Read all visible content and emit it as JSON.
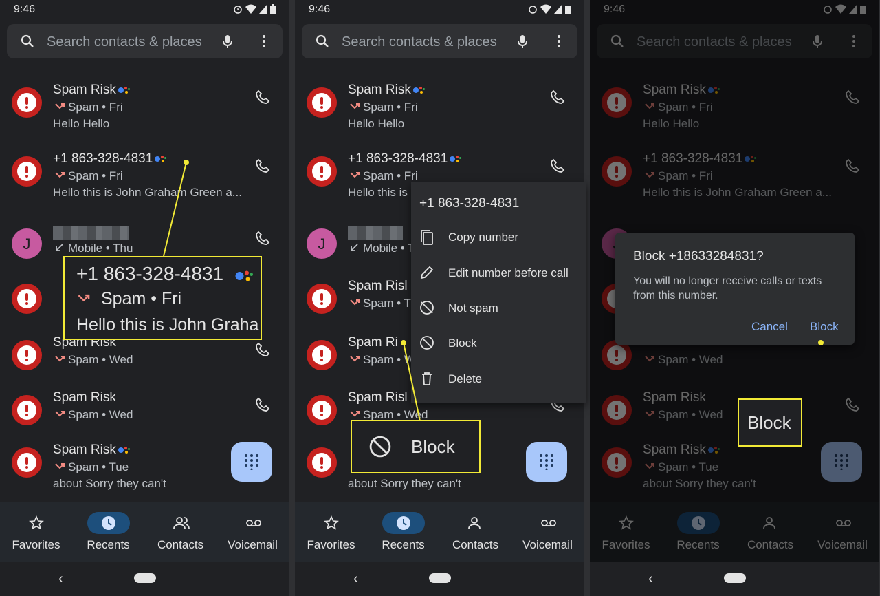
{
  "status": {
    "time": "9:46"
  },
  "search": {
    "placeholder": "Search contacts & places"
  },
  "calls": [
    {
      "name": "Spam Risk",
      "assistant": true,
      "line2": "Spam • Fri",
      "line3": "Hello  Hello"
    },
    {
      "name": "+1 863-328-4831",
      "assistant": true,
      "line2": "Spam • Fri",
      "line3": "Hello this is John Graham Green a..."
    },
    {
      "name": "",
      "line2": "Mobile • Thu",
      "avatar_letter": "J"
    },
    {
      "name": "Spam Risk",
      "line2": "Spam • Thu"
    },
    {
      "name": "Spam Risk",
      "line2": "Spam • Wed"
    },
    {
      "name": "Spam Risk",
      "line2": "Spam • Wed"
    },
    {
      "name": "Spam Risk",
      "assistant": true,
      "line2": "Spam • Tue",
      "line3": "about Sorry they can't"
    }
  ],
  "nav": {
    "favorites": "Favorites",
    "recents": "Recents",
    "contacts": "Contacts",
    "voicemail": "Voicemail",
    "active": "recents"
  },
  "callout1": {
    "number": "+1 863-328-4831",
    "line2": "Spam • Fri",
    "line3": "Hello this is John Graha"
  },
  "menu": {
    "header": "+1 863-328-4831",
    "items": [
      "Copy number",
      "Edit number before call",
      "Not spam",
      "Block",
      "Delete"
    ]
  },
  "callout2": {
    "label": "Block"
  },
  "panel2_partial": {
    "row2_line3": "Hello this is",
    "row4_name": "Spam Risl",
    "row5_name": "Spam Ri",
    "row6_name": "Spam Risl",
    "row6_line2": "Spam • Wed"
  },
  "dialog": {
    "title": "Block +18633284831?",
    "body": "You will no longer receive calls or texts from this number.",
    "cancel": "Cancel",
    "confirm": "Block"
  },
  "callout3": {
    "label": "Block"
  },
  "colors": {
    "highlight": "#f2ea36",
    "spam_red": "#c5221f",
    "accent": "#8ab4f8",
    "fab": "#a8c7fa"
  }
}
